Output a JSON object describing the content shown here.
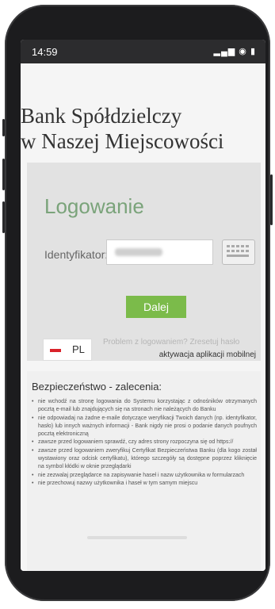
{
  "status_bar": {
    "time": "14:59",
    "icons_text": "▁▃▅ ▽ ▮"
  },
  "bank": {
    "title_line1": "Bank Spółdzielczy",
    "title_line2": "w Naszej Miejscowości"
  },
  "login": {
    "title": "Logowanie",
    "identifier_label": "Identyfikator:",
    "identifier_value": "",
    "next_button": "Dalej",
    "language": {
      "code": "PL"
    },
    "problem_link": "Problem z logowaniem? Zresetuj hasło",
    "activation_link": "aktywacja aplikacji mobilnej"
  },
  "security": {
    "title": "Bezpieczeństwo - zalecenia:",
    "items": [
      "nie wchodź na stronę logowania do Systemu korzystając z odnośników otrzymanych pocztą e-mail lub znajdujących się na stronach nie należących do Banku",
      "nie odpowiadaj na żadne e-maile dotyczące weryfikacji Twoich danych (np. identyfikator, hasło) lub innych ważnych informacji - Bank nigdy nie prosi o podanie danych poufnych pocztą elektroniczną",
      "zawsze przed logowaniem sprawdź, czy adres strony rozpoczyna się od https://",
      "zawsze przed logowaniem zweryfikuj Certyfikat Bezpieczeństwa Banku (dla kogo został wystawiony oraz odcisk certyfikatu), którego szczegóły są dostępne poprzez kliknięcie na symbol kłódki w oknie przeglądarki",
      "nie zezwalaj przeglądarce na zapisywanie haseł i nazw użytkownika w formularzach",
      "nie przechowuj nazwy użytkownika i haseł w tym samym miejscu"
    ]
  }
}
